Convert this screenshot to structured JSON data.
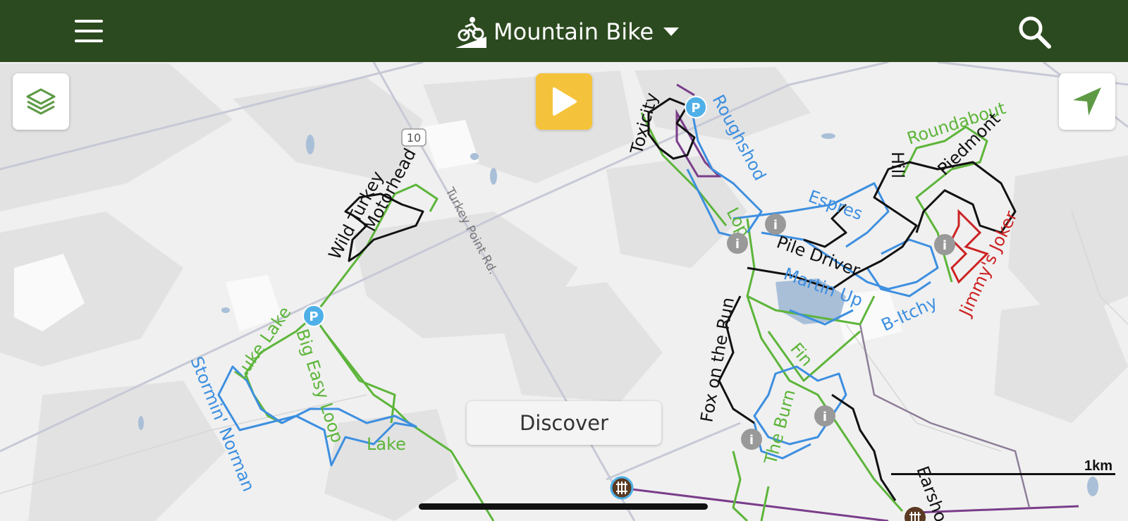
{
  "header": {
    "title": "Mountain Bike",
    "activity_icon": "mountain-bike-icon",
    "menu_icon": "hamburger-menu-icon",
    "search_icon": "search-icon",
    "dropdown_icon": "chevron-down-icon"
  },
  "controls": {
    "layers_icon": "layers-icon",
    "play_icon": "play-icon",
    "locate_icon": "navigation-arrow-icon",
    "discover_label": "Discover"
  },
  "map": {
    "road_shield": "10",
    "road_name": "Turkey Point Rd.",
    "scale_label": "1km",
    "trail_labels": {
      "wild_turkey": "Wild Turkey",
      "motorhead": "Motorhead",
      "big_easy": "Big Easy Loop",
      "luke_lake": "Luke Lake",
      "stormin_norman": "Stormin' Norman",
      "lake": "Lake",
      "toxicity": "Toxicity",
      "roughshod": "Roughshod",
      "lop": "Lop",
      "espresso": "Espres",
      "pile_driver": "Pile Driver",
      "martin_up": "Martin Up",
      "b_itchy": "B-Itchy",
      "roundabout": "Roundabout",
      "piedmont": "Piedmont",
      "hill": "Hill",
      "jimmys_joker": "Jimmy's Joker",
      "fox_on_the_run": "Fox on the Run",
      "fin": "Fin",
      "the_burn": "The Burn",
      "earshot": "Earsho"
    },
    "colors": {
      "header_bg": "#2c4a1f",
      "trail_green": "#5db53a",
      "trail_blue": "#3d8fe0",
      "trail_black": "#111111",
      "trail_red": "#cc2222",
      "trail_purple": "#7a3d8a",
      "play_yellow": "#f5c33b",
      "marker_blue": "#4fb0e8",
      "info_gray": "#999999",
      "gate_brown": "#5a3a22"
    }
  }
}
